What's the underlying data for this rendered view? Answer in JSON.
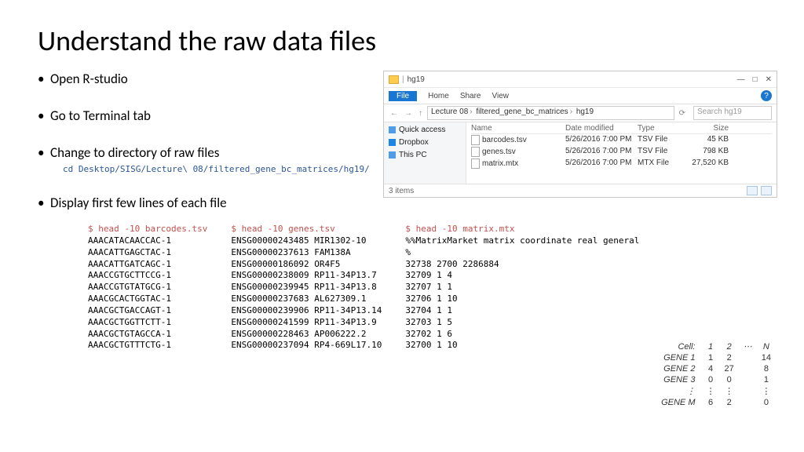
{
  "title": "Understand the raw data files",
  "bullets": {
    "b1": "Open R-studio",
    "b2": "Go to Terminal tab",
    "b3": "Change to directory of raw files",
    "b4": "Display first few lines of each file"
  },
  "cd_cmd": "cd Desktop/SISG/Lecture\\ 08/filtered_gene_bc_matrices/hg19/",
  "terminal": {
    "barcodes": {
      "head": "$ head -10 barcodes.tsv",
      "body": "AAACATACAACCAC-1\nAAACATTGAGCTAC-1\nAAACATTGATCAGC-1\nAAACCGTGCTTCCG-1\nAAACCGTGTATGCG-1\nAAACGCACTGGTAC-1\nAAACGCTGACCAGT-1\nAAACGCTGGTTCTT-1\nAAACGCTGTAGCCA-1\nAAACGCTGTTTCTG-1"
    },
    "genes": {
      "head": "$ head -10 genes.tsv",
      "body": "ENSG00000243485 MIR1302-10\nENSG00000237613 FAM138A\nENSG00000186092 OR4F5\nENSG00000238009 RP11-34P13.7\nENSG00000239945 RP11-34P13.8\nENSG00000237683 AL627309.1\nENSG00000239906 RP11-34P13.14\nENSG00000241599 RP11-34P13.9\nENSG00000228463 AP006222.2\nENSG00000237094 RP4-669L17.10"
    },
    "matrix": {
      "head": "$ head -10 matrix.mtx",
      "body": "%%MatrixMarket matrix coordinate real general\n%\n32738 2700 2286884\n32709 1 4\n32707 1 1\n32706 1 10\n32704 1 1\n32703 1 5\n32702 1 6\n32700 1 10"
    }
  },
  "explorer": {
    "folder_name": "hg19",
    "win": {
      "min": "—",
      "max": "□",
      "close": "✕"
    },
    "ribbon": {
      "file": "File",
      "home": "Home",
      "share": "Share",
      "view": "View"
    },
    "help": "?",
    "nav": {
      "back": "←",
      "fwd": "→",
      "up": "↑",
      "refresh": "⟳",
      "search_icon": "🔍"
    },
    "breadcrumbs": [
      "Lecture 08",
      "filtered_gene_bc_matrices",
      "hg19"
    ],
    "search_placeholder": "Search hg19",
    "sidebar": {
      "quick": "Quick access",
      "dropbox": "Dropbox",
      "thispc": "This PC"
    },
    "cols": {
      "name": "Name",
      "date": "Date modified",
      "type": "Type",
      "size": "Size"
    },
    "files": [
      {
        "name": "barcodes.tsv",
        "date": "5/26/2016 7:00 PM",
        "type": "TSV File",
        "size": "45 KB"
      },
      {
        "name": "genes.tsv",
        "date": "5/26/2016 7:00 PM",
        "type": "TSV File",
        "size": "798 KB"
      },
      {
        "name": "matrix.mtx",
        "date": "5/26/2016 7:00 PM",
        "type": "MTX File",
        "size": "27,520 KB"
      }
    ],
    "status": "3 items"
  },
  "matrix_diagram": {
    "corner": "Cell:",
    "cols": [
      "1",
      "2",
      "⋯",
      "N"
    ],
    "rows": [
      {
        "label": "GENE 1",
        "vals": [
          "1",
          "2",
          "",
          "14"
        ]
      },
      {
        "label": "GENE 2",
        "vals": [
          "4",
          "27",
          "",
          "8"
        ]
      },
      {
        "label": "GENE 3",
        "vals": [
          "0",
          "0",
          "",
          "1"
        ]
      },
      {
        "label": "⋮",
        "vals": [
          "⋮",
          "⋮",
          "",
          "⋮"
        ]
      },
      {
        "label": "GENE M",
        "vals": [
          "6",
          "2",
          "",
          "0"
        ]
      }
    ]
  }
}
